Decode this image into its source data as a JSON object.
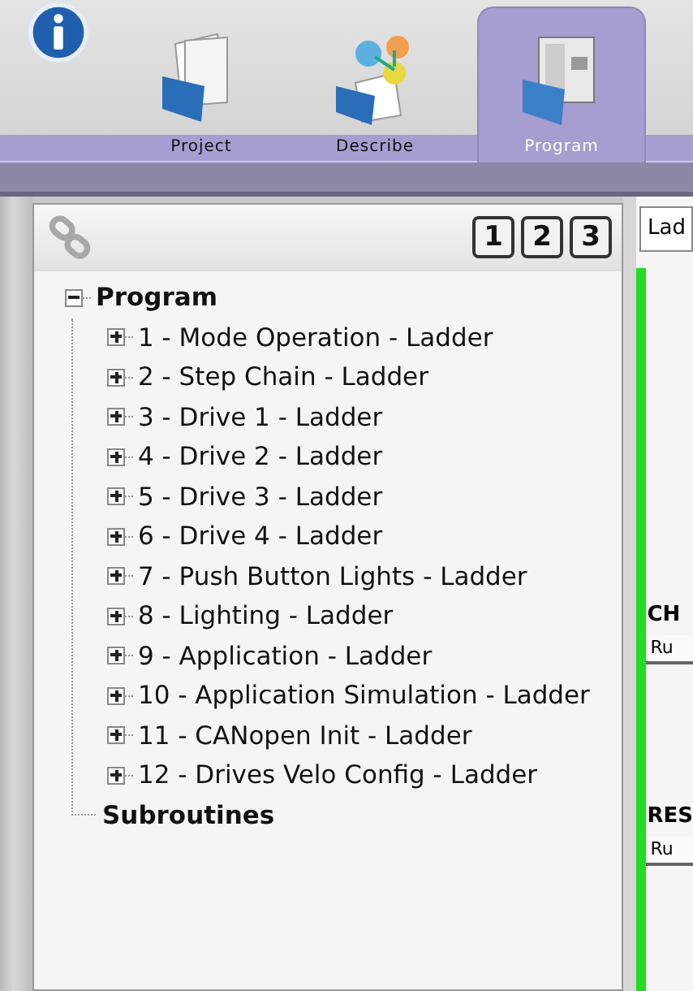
{
  "tabs": [
    {
      "label": "Project",
      "kind": "project",
      "selected": false
    },
    {
      "label": "Describe",
      "kind": "describe",
      "selected": false
    },
    {
      "label": "Program",
      "kind": "program",
      "selected": true
    }
  ],
  "tree_toolbar": {
    "view_buttons": [
      "1",
      "2",
      "3"
    ]
  },
  "tree": [
    {
      "label": "Program",
      "expandable": true,
      "expanded": true,
      "children": [
        {
          "label": "1 - Mode Operation - Ladder",
          "expandable": true,
          "expanded": false
        },
        {
          "label": "2 - Step Chain - Ladder",
          "expandable": true,
          "expanded": false
        },
        {
          "label": "3 - Drive 1 - Ladder",
          "expandable": true,
          "expanded": false
        },
        {
          "label": "4 - Drive 2 - Ladder",
          "expandable": true,
          "expanded": false
        },
        {
          "label": "5 - Drive 3 - Ladder",
          "expandable": true,
          "expanded": false
        },
        {
          "label": "6 - Drive 4 - Ladder",
          "expandable": true,
          "expanded": false
        },
        {
          "label": "7 - Push Button Lights - Ladder",
          "expandable": true,
          "expanded": false
        },
        {
          "label": "8 - Lighting - Ladder",
          "expandable": true,
          "expanded": false
        },
        {
          "label": "9 - Application - Ladder",
          "expandable": true,
          "expanded": false
        },
        {
          "label": "10 - Application Simulation - Ladder",
          "expandable": true,
          "expanded": false
        },
        {
          "label": "11 - CANopen Init - Ladder",
          "expandable": true,
          "expanded": false
        },
        {
          "label": "12 - Drives Velo Config - Ladder",
          "expandable": true,
          "expanded": false
        }
      ]
    },
    {
      "label": "Subroutines",
      "expandable": false
    }
  ],
  "editor": {
    "language_select": "Lad",
    "rungs": [
      {
        "title": "CH",
        "field": "Ru"
      },
      {
        "title": "RES",
        "field": "Ru"
      }
    ]
  }
}
